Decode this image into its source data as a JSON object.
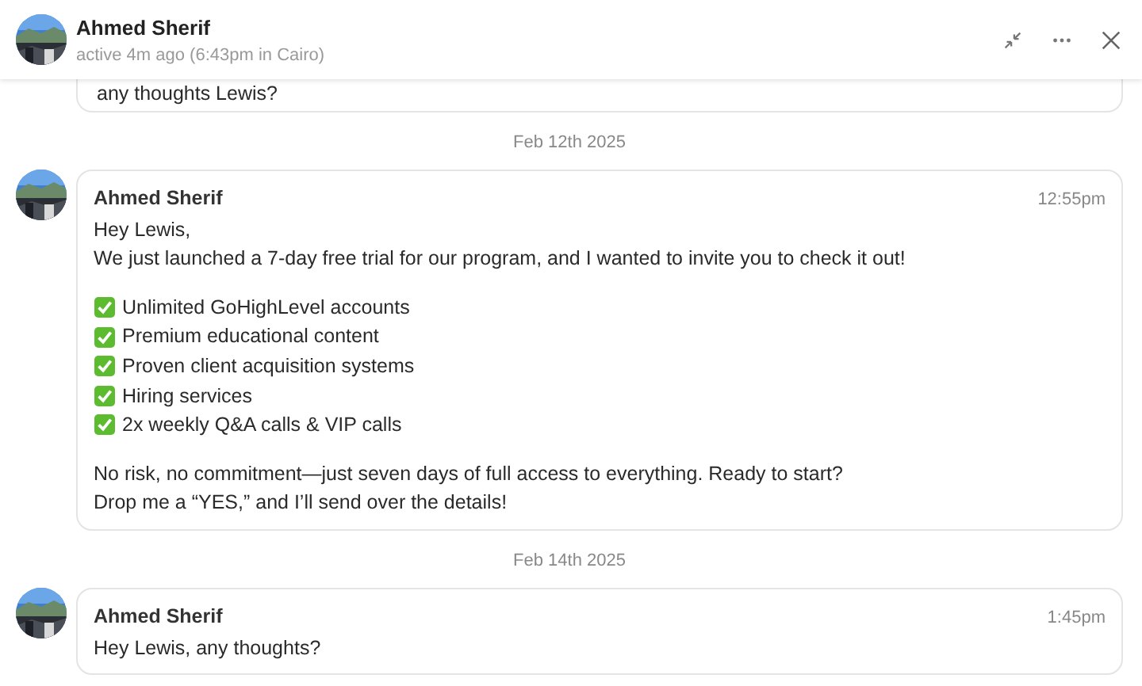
{
  "header": {
    "name": "Ahmed Sherif",
    "status": "active 4m ago (6:43pm in Cairo)"
  },
  "partial_message": {
    "text": "any thoughts Lewis?"
  },
  "thread": [
    {
      "kind": "date",
      "text": "Feb 12th 2025"
    },
    {
      "kind": "message",
      "sender": "Ahmed Sherif",
      "time": "12:55pm",
      "blocks": [
        {
          "kind": "para",
          "lines": [
            "Hey Lewis,",
            "We just launched a 7-day free trial for our program, and I wanted to invite you to check it out!"
          ]
        },
        {
          "kind": "checklist",
          "items": [
            "Unlimited GoHighLevel accounts",
            "Premium educational content",
            "Proven client acquisition systems",
            "Hiring services",
            "2x weekly Q&A calls & VIP calls"
          ]
        },
        {
          "kind": "para",
          "lines": [
            "No risk, no commitment—just seven days of full access to everything. Ready to start?",
            "Drop me a “YES,” and I’ll send over the details!"
          ]
        }
      ]
    },
    {
      "kind": "date",
      "text": "Feb 14th 2025"
    },
    {
      "kind": "message",
      "sender": "Ahmed Sherif",
      "time": "1:45pm",
      "blocks": [
        {
          "kind": "para",
          "lines": [
            "Hey Lewis, any thoughts?"
          ]
        }
      ]
    }
  ]
}
